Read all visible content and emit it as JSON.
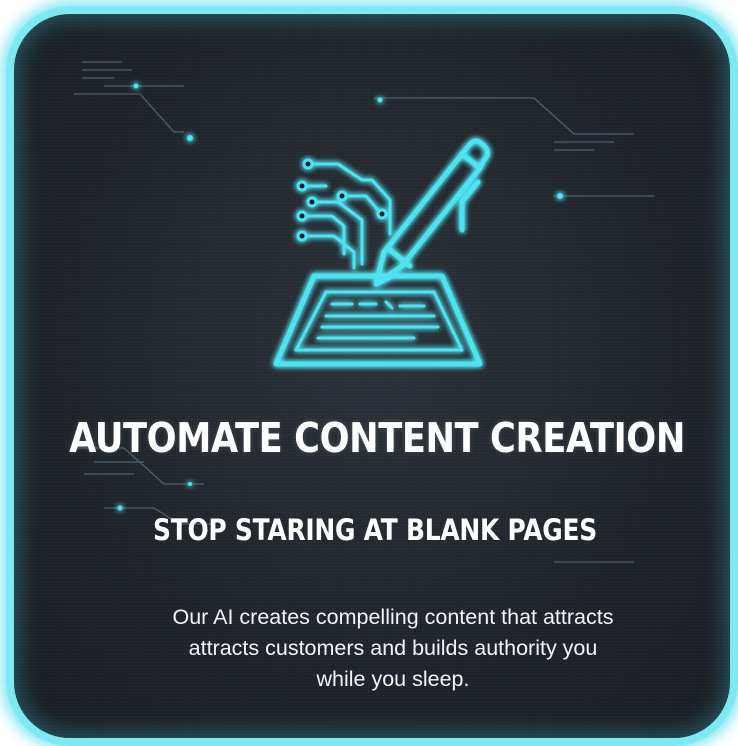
{
  "card": {
    "headline": "AUTOMATE CONTENT CREATION",
    "subheadline": "STOP STARING AT BLANK PAGES",
    "body_lines": [
      "Our AI creates compelling content that attracts",
      "attracts customers and builds authority you",
      "while you sleep."
    ]
  },
  "icon": {
    "name": "ai-pen-writing-icon"
  },
  "colors": {
    "accent": "#4fe3f1",
    "border": "#7fe9f3",
    "background": "#1f242a",
    "text": "#ffffff"
  }
}
